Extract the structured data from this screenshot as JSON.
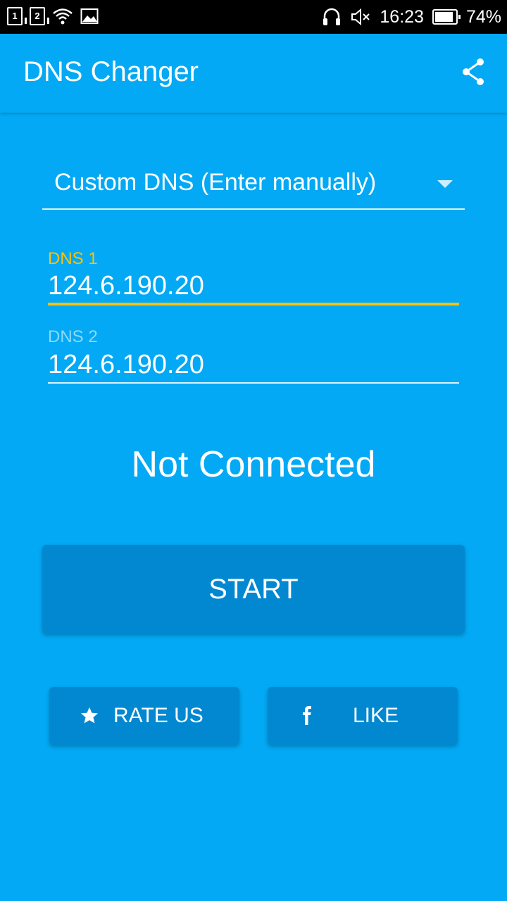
{
  "status_bar": {
    "sim1": "1",
    "sim2": "2",
    "time": "16:23",
    "battery": "74%",
    "icons": [
      "sim1-icon",
      "sim2-icon",
      "wifi-icon",
      "image-icon",
      "headset-icon",
      "mute-icon",
      "battery-icon"
    ]
  },
  "app_bar": {
    "title": "DNS Changer",
    "share_icon": "share-icon"
  },
  "dns_select": {
    "selected": "Custom DNS (Enter manually)"
  },
  "dns1": {
    "label": "DNS 1",
    "value": "124.6.190.20"
  },
  "dns2": {
    "label": "DNS 2",
    "value": "124.6.190.20"
  },
  "connection_status": "Not Connected",
  "buttons": {
    "start": "START",
    "rate": "RATE US",
    "like": "LIKE"
  },
  "colors": {
    "background": "#03A9F4",
    "button": "#0288D1",
    "accent": "#FFC107"
  }
}
